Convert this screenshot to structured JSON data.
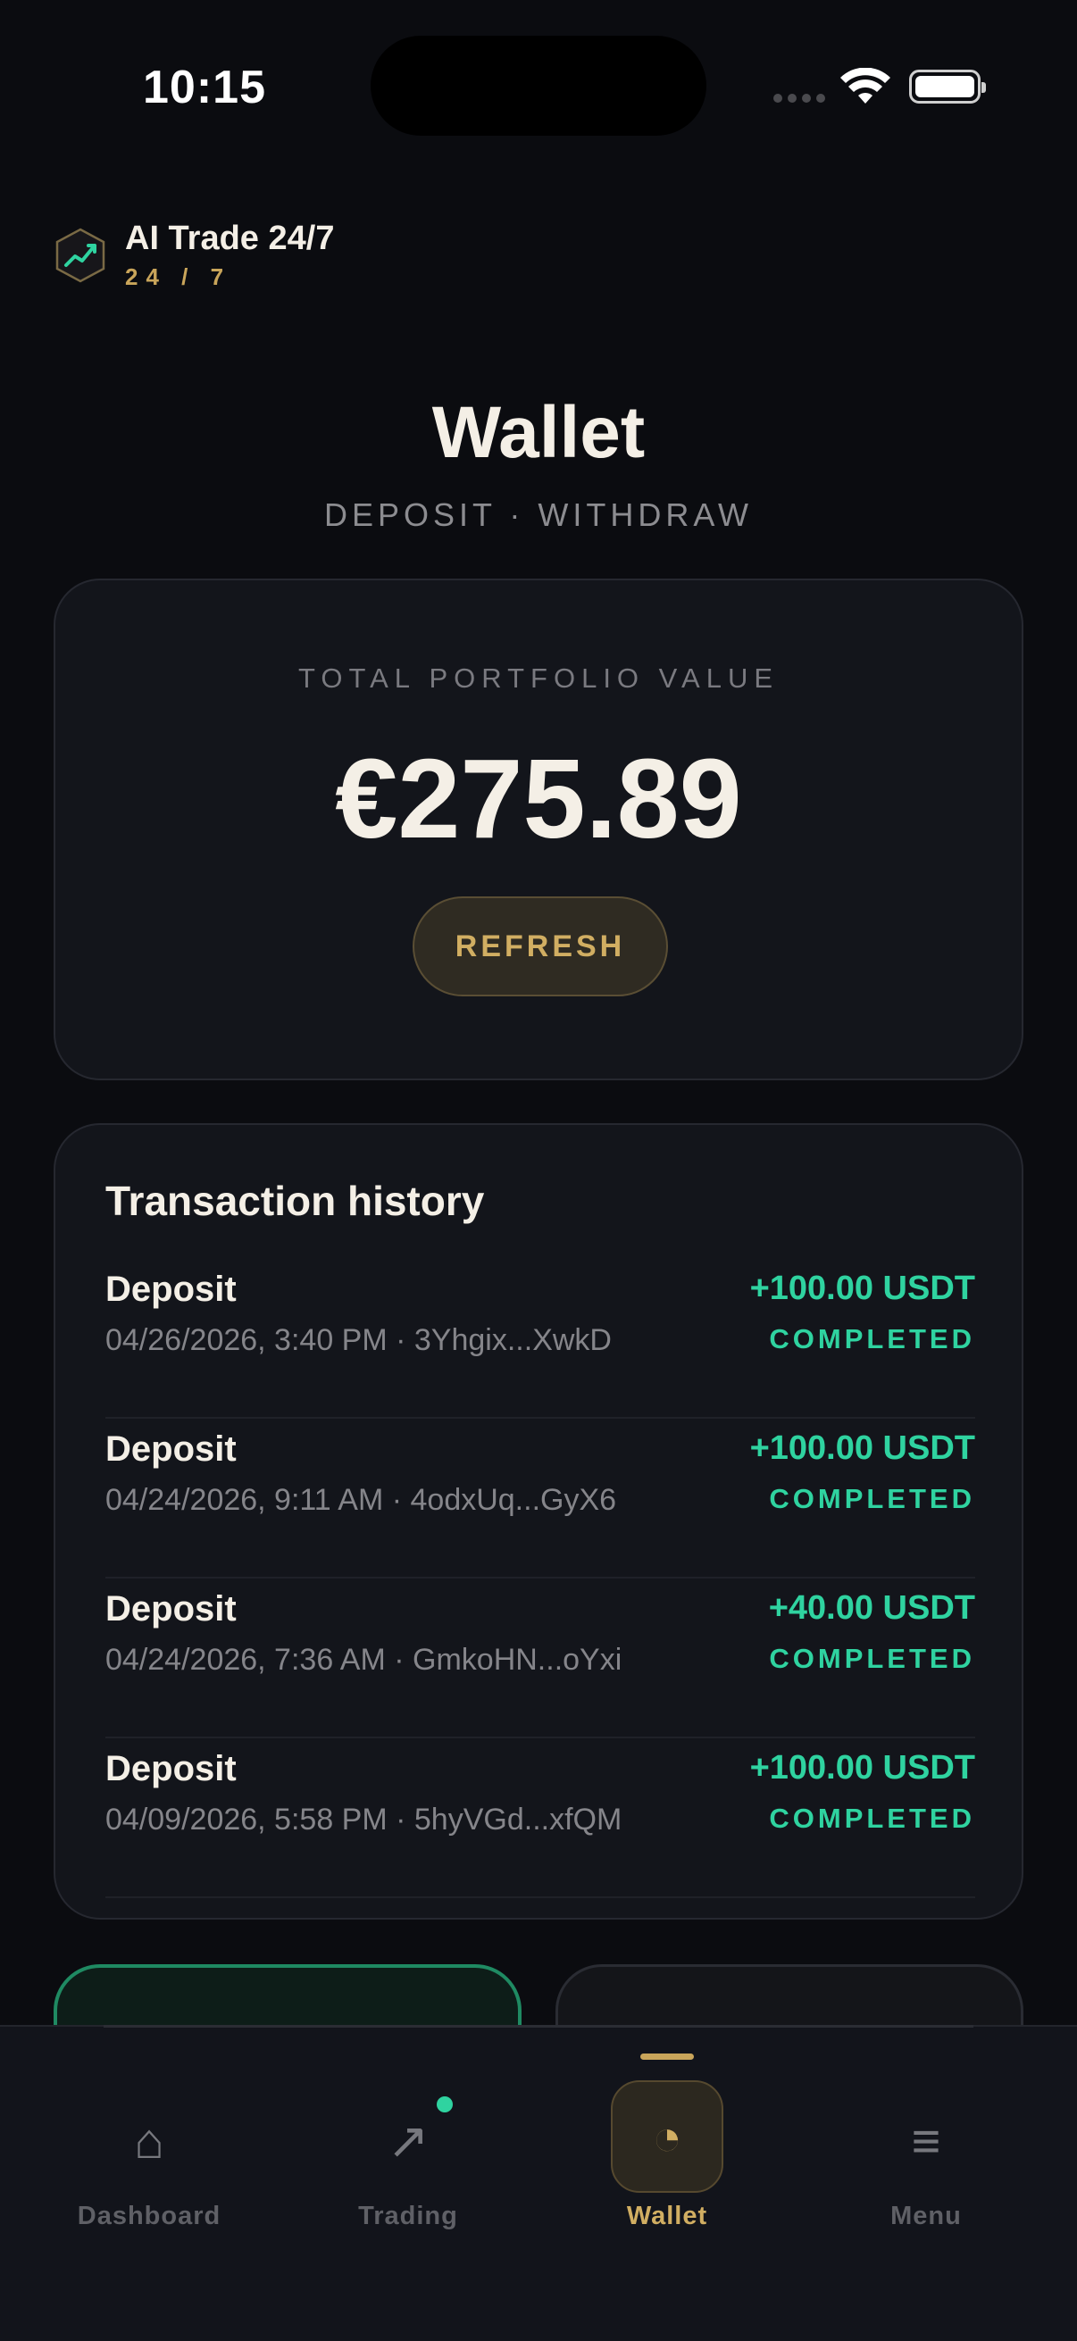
{
  "status_bar": {
    "time": "10:15"
  },
  "brand": {
    "name": "AI Trade 24/7",
    "sub": "24 / 7"
  },
  "header": {
    "title": "Wallet",
    "subtitle": "DEPOSIT · WITHDRAW"
  },
  "portfolio": {
    "label": "TOTAL PORTFOLIO VALUE",
    "value": "€275.89",
    "refresh_label": "REFRESH"
  },
  "history": {
    "title": "Transaction history",
    "transactions": [
      {
        "type": "Deposit",
        "meta": "04/26/2026, 3:40 PM · 3Yhgix...XwkD",
        "amount": "+100.00 USDT",
        "status": "COMPLETED"
      },
      {
        "type": "Deposit",
        "meta": "04/24/2026, 9:11 AM · 4odxUq...GyX6",
        "amount": "+100.00 USDT",
        "status": "COMPLETED"
      },
      {
        "type": "Deposit",
        "meta": "04/24/2026, 7:36 AM · GmkoHN...oYxi",
        "amount": "+40.00 USDT",
        "status": "COMPLETED"
      },
      {
        "type": "Deposit",
        "meta": "04/09/2026, 5:58 PM · 5hyVGd...xfQM",
        "amount": "+100.00 USDT",
        "status": "COMPLETED"
      }
    ]
  },
  "tabs": [
    {
      "label": "Dashboard",
      "icon": "home-icon",
      "glyph": "⌂"
    },
    {
      "label": "Trading",
      "icon": "arrow-up-right-icon",
      "glyph": "↗"
    },
    {
      "label": "Wallet",
      "icon": "pie-chart-icon",
      "glyph": "◔"
    },
    {
      "label": "Menu",
      "icon": "hamburger-menu-icon",
      "glyph": "≡"
    }
  ],
  "colors": {
    "accent_gold": "#c9a55a",
    "success_green": "#2fd3a0",
    "background": "#0b0c10",
    "card": "#13151b"
  }
}
